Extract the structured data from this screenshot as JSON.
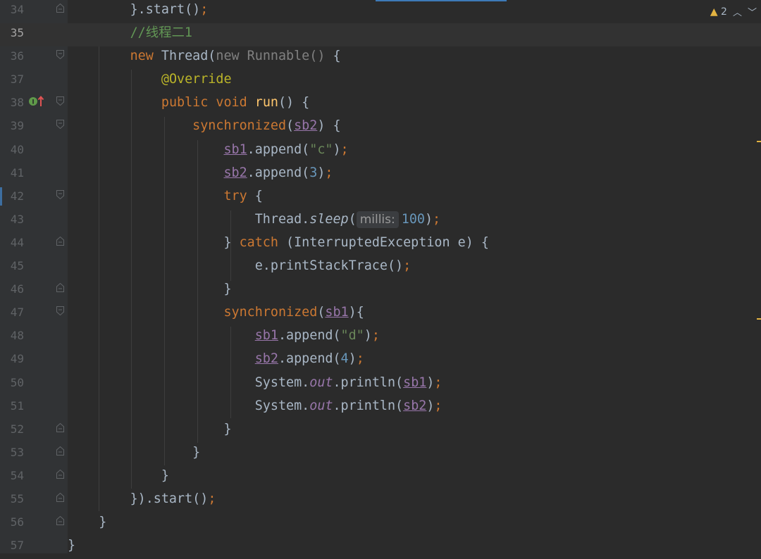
{
  "editor": {
    "warnings": {
      "count": "2"
    },
    "lines": [
      {
        "num": "34",
        "html": "<span class=\"g\"></span>        }.start()<span class=\"kw\">;</span>"
      },
      {
        "num": "35",
        "current": true,
        "html": "        <span class=\"cmt\">//线程二1</span>"
      },
      {
        "num": "36",
        "html": "        <span class=\"kw\">new </span>Thread(<span class=\"dim\">new Runnable() </span>{"
      },
      {
        "num": "37",
        "html": "            <span class=\"ann\">@Override</span>"
      },
      {
        "num": "38",
        "html": "            <span class=\"kw\">public void </span><span class=\"meth\">run</span>() {"
      },
      {
        "num": "39",
        "html": "                <span class=\"kw\">synchronized</span>(<span class=\"fld und\">sb2</span>) {"
      },
      {
        "num": "40",
        "html": "                    <span class=\"fld und\">sb1</span>.append(<span class=\"str\">\"c\"</span>)<span class=\"kw\">;</span>"
      },
      {
        "num": "41",
        "html": "                    <span class=\"fld und\">sb2</span>.append(<span class=\"num\">3</span>)<span class=\"kw\">;</span>"
      },
      {
        "num": "42",
        "html": "                    <span class=\"kw\">try </span>{"
      },
      {
        "num": "43",
        "html": "                        Thread.<span class=\"stat\">sleep</span>(<span class=\"hint\">millis:</span><span class=\"num\">100</span>)<span class=\"kw\">;</span>"
      },
      {
        "num": "44",
        "html": "                    } <span class=\"kw\">catch </span>(InterruptedException e) {"
      },
      {
        "num": "45",
        "html": "                        e.printStackTrace()<span class=\"kw\">;</span>"
      },
      {
        "num": "46",
        "html": "                    }"
      },
      {
        "num": "47",
        "html": "                    <span class=\"kw\">synchronized</span>(<span class=\"fld und\">sb1</span>){"
      },
      {
        "num": "48",
        "html": "                        <span class=\"fld und\">sb1</span>.append(<span class=\"str\">\"d\"</span>)<span class=\"kw\">;</span>"
      },
      {
        "num": "49",
        "html": "                        <span class=\"fld und\">sb2</span>.append(<span class=\"num\">4</span>)<span class=\"kw\">;</span>"
      },
      {
        "num": "50",
        "html": "                        System.<span class=\"fldi\">out</span>.println(<span class=\"fld und\">sb1</span>)<span class=\"kw\">;</span>"
      },
      {
        "num": "51",
        "html": "                        System.<span class=\"fldi\">out</span>.println(<span class=\"fld und\">sb2</span>)<span class=\"kw\">;</span>"
      },
      {
        "num": "52",
        "html": "                    }"
      },
      {
        "num": "53",
        "html": "                }"
      },
      {
        "num": "54",
        "html": "            }"
      },
      {
        "num": "55",
        "html": "        }).start()<span class=\"kw\">;</span>"
      },
      {
        "num": "56",
        "html": "    }"
      },
      {
        "num": "57",
        "html": "}"
      }
    ]
  }
}
